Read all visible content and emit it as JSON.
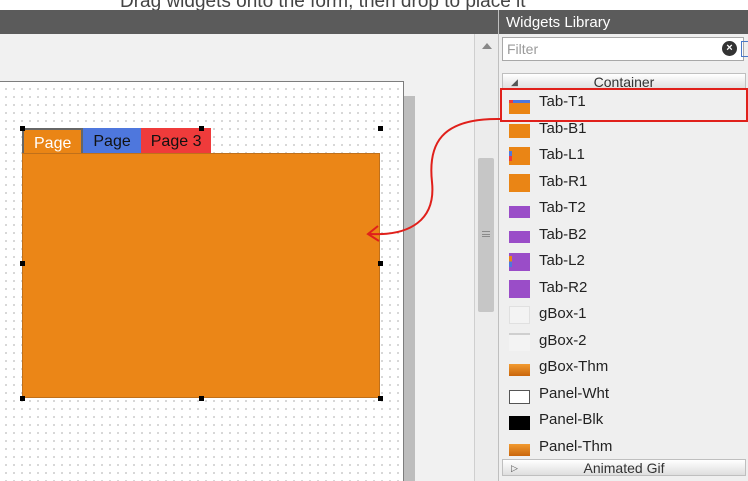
{
  "top_banner_text": "Drag widgets onto the form, then drop to place it",
  "form": {
    "tabs": [
      {
        "label": "Page"
      },
      {
        "label": "Page"
      },
      {
        "label": "Page 3"
      }
    ]
  },
  "library": {
    "title": "Widgets Library",
    "filter_placeholder": "Filter",
    "categories": [
      {
        "label": "Container",
        "expanded": true
      },
      {
        "label": "Animated Gif",
        "expanded": false
      }
    ],
    "items": [
      {
        "label": "Tab-T1",
        "icon": "tab-t1-icon"
      },
      {
        "label": "Tab-B1",
        "icon": "tab-b1-icon"
      },
      {
        "label": "Tab-L1",
        "icon": "tab-l1-icon"
      },
      {
        "label": "Tab-R1",
        "icon": "tab-r1-icon"
      },
      {
        "label": "Tab-T2",
        "icon": "tab-t2-icon"
      },
      {
        "label": "Tab-B2",
        "icon": "tab-b2-icon"
      },
      {
        "label": "Tab-L2",
        "icon": "tab-l2-icon"
      },
      {
        "label": "Tab-R2",
        "icon": "tab-r2-icon"
      },
      {
        "label": "gBox-1",
        "icon": "gbox-1-icon"
      },
      {
        "label": "gBox-2",
        "icon": "gbox-2-icon"
      },
      {
        "label": "gBox-Thm",
        "icon": "gbox-thm-icon"
      },
      {
        "label": "Panel-Wht",
        "icon": "panel-wht-icon"
      },
      {
        "label": "Panel-Blk",
        "icon": "panel-blk-icon"
      },
      {
        "label": "Panel-Thm",
        "icon": "panel-thm-icon"
      }
    ],
    "highlighted_item": "Tab-T1"
  },
  "colors": {
    "tab_orange": "#ea8515",
    "tab_blue": "#4e77dd",
    "tab_red": "#ef3b3b",
    "purple": "#9a4dc8",
    "annotation_red": "#e0201b",
    "titlebar": "#5b5b5b"
  }
}
